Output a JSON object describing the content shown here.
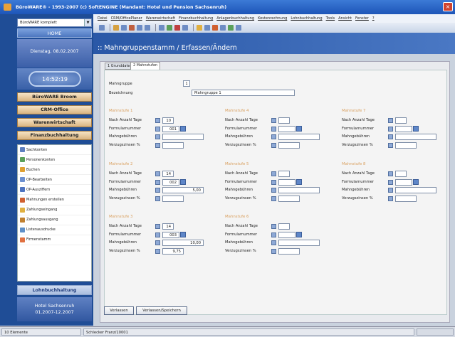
{
  "window": {
    "title": "BüroWARE® - 1993-2007 (c) SoftENGINE  (Mandant: Hotel und Pension Sachsenruh)"
  },
  "left": {
    "combo_value": "BüroWARE komplett",
    "home": "HOME",
    "date": "Dienstag, 08.02.2007",
    "clock": "14:52:19",
    "modules": [
      "BüroWARE Broom",
      "CRM-Office",
      "Warenwirtschaft",
      "Finanzbuchhaltung"
    ],
    "nav_items": [
      {
        "label": "Sachkonten",
        "color": "#5d7fc0"
      },
      {
        "label": "Personenkonten",
        "color": "#5aa05a"
      },
      {
        "label": "Buchen",
        "color": "#e0a030"
      },
      {
        "label": "OP-Bearbeiten",
        "color": "#6b8fd0"
      },
      {
        "label": "OP-Ausziffern",
        "color": "#4d73c0"
      },
      {
        "label": "Mahnungen erstellen",
        "color": "#d06030"
      },
      {
        "label": "Zahlungseingang",
        "color": "#e0b040"
      },
      {
        "label": "Zahlungsausgang",
        "color": "#c08030"
      },
      {
        "label": "Listenausdrucke",
        "color": "#5d8fc8"
      },
      {
        "label": "Firmenstamm",
        "color": "#e07040"
      }
    ],
    "lohn": "Lohnbuchhaltung",
    "hotel": [
      "Hotel Sachsenruh",
      "01.2007-12.2007"
    ]
  },
  "menu": [
    "Datei",
    "CRM/OfficePlaner",
    "Warenwirtschaft",
    "Finanzbuchhaltung",
    "Anlagenbuchhaltung",
    "Kostenrechnung",
    "Lohnbuchhaltung",
    "Tools",
    "Ansicht",
    "Fenster",
    "?"
  ],
  "header": {
    "title": ":: Mahngruppenstamm / Erfassen/Ändern"
  },
  "tabs": [
    "1 Grunddaten",
    "2 Mahnstufen"
  ],
  "form": {
    "mahngruppe_label": "Mahngruppe",
    "mahngruppe_value": "1",
    "bezeichnung_label": "Bezeichnung",
    "bezeichnung_value": "Mahngruppe 1",
    "field_labels": [
      "Nach Anzahl Tage",
      "Formularnummer",
      "Mahngebühren",
      "Verzugszinsen %"
    ],
    "stufen": [
      {
        "title": "Mahnstufe 1",
        "tage": "10",
        "formular": "001",
        "gebuehren": "",
        "zinsen": ""
      },
      {
        "title": "Mahnstufe 2",
        "tage": "14",
        "formular": "002",
        "gebuehren": "5,00",
        "zinsen": ""
      },
      {
        "title": "Mahnstufe 3",
        "tage": "14",
        "formular": "003",
        "gebuehren": "10,00",
        "zinsen": "9,75"
      },
      {
        "title": "Mahnstufe 4",
        "tage": "",
        "formular": "",
        "gebuehren": "",
        "zinsen": ""
      },
      {
        "title": "Mahnstufe 5",
        "tage": "",
        "formular": "",
        "gebuehren": "",
        "zinsen": ""
      },
      {
        "title": "Mahnstufe 6",
        "tage": "",
        "formular": "",
        "gebuehren": "",
        "zinsen": ""
      },
      {
        "title": "Mahnstufe 7",
        "tage": "",
        "formular": "",
        "gebuehren": "",
        "zinsen": ""
      },
      {
        "title": "Mahnstufe 8",
        "tage": "",
        "formular": "",
        "gebuehren": "",
        "zinsen": ""
      }
    ]
  },
  "buttons": {
    "verlassen": "Verlassen",
    "speichern": "Verlassen/Speichern"
  },
  "status": {
    "left": "10 Elemente",
    "middle": "Schlecker Franz/10001"
  }
}
